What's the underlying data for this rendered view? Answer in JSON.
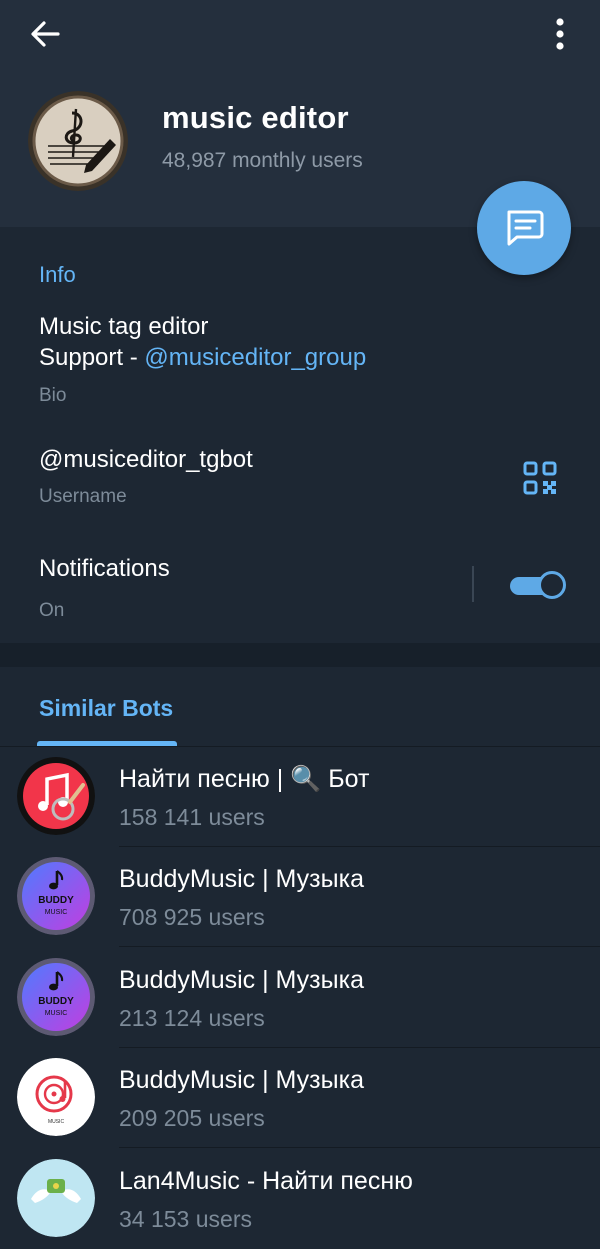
{
  "colors": {
    "header_bg": "#242f3d",
    "page_bg": "#1d2733",
    "accent": "#64b5f6",
    "fab": "#5ea9e6",
    "secondary_text": "#8e9aa7"
  },
  "toolbar": {
    "back_icon": "arrow-left-icon",
    "menu_icon": "more-vertical-icon"
  },
  "profile": {
    "name": "music editor",
    "subtitle": "48,987 monthly users",
    "avatar_icon": "music-note-pencil-avatar",
    "message_button_icon": "message-icon"
  },
  "info": {
    "section_title": "Info",
    "bio_line1": "Music tag editor",
    "bio_line2_prefix": "Support - ",
    "bio_line2_link": "@musiceditor_group",
    "bio_caption": "Bio",
    "username": "@musiceditor_tgbot",
    "username_caption": "Username",
    "qr_icon": "qr-code-icon",
    "notifications_label": "Notifications",
    "notifications_value": "On",
    "notifications_enabled": true
  },
  "similar": {
    "tab_label": "Similar Bots",
    "bots": [
      {
        "name": "Найти песню | 🔍 Бот",
        "users": "158 141 users",
        "avatar_icon": "apple-music-search-avatar"
      },
      {
        "name": "BuddyMusic | Музыка",
        "users": "708 925 users",
        "avatar_icon": "buddy-music-avatar"
      },
      {
        "name": "BuddyMusic | Музыка",
        "users": "213 124 users",
        "avatar_icon": "buddy-music-avatar"
      },
      {
        "name": "BuddyMusic | Музыка",
        "users": "209 205 users",
        "avatar_icon": "music-disc-avatar"
      },
      {
        "name": "Lan4Music - Найти песню",
        "users": "34 153 users",
        "avatar_icon": "lan4music-avatar"
      }
    ]
  },
  "avatar_text": {
    "buddy_top": "BUDDY",
    "buddy_bottom": "MUSIC",
    "disc_caption": "MUSIC"
  }
}
